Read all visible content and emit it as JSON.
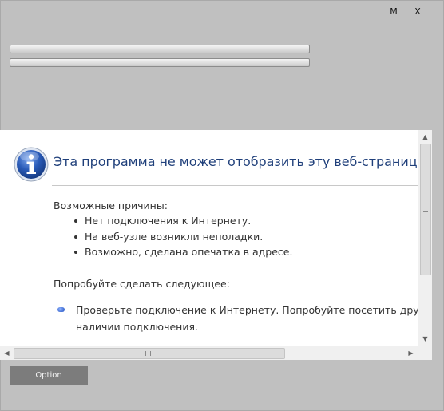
{
  "window": {
    "maximize_label": "M",
    "close_label": "X"
  },
  "progress_bars": [
    {
      "value_percent": 0
    },
    {
      "value_percent": 0
    }
  ],
  "browser": {
    "error_title": "Эта программа не может отобразить эту веб-страницу",
    "causes_heading": "Возможные причины:",
    "causes": [
      "Нет подключения к Интернету.",
      "На веб-узле возникли неполадки.",
      "Возможно, сделана опечатка в адресе."
    ],
    "try_heading": "Попробуйте сделать следующее:",
    "try_items": [
      {
        "line1": "Проверьте подключение к Интернету. Попробуйте посетить другой",
        "line2": "наличии подключения."
      }
    ],
    "icons": {
      "info": "info-icon",
      "scroll_up": "arrow-up-icon",
      "scroll_down": "arrow-down-icon",
      "scroll_left": "arrow-left-icon",
      "scroll_right": "arrow-right-icon"
    },
    "colors": {
      "title": "#1f3f7a",
      "info_icon": "#1f4ea3"
    }
  },
  "option_button": {
    "label": "Option"
  }
}
